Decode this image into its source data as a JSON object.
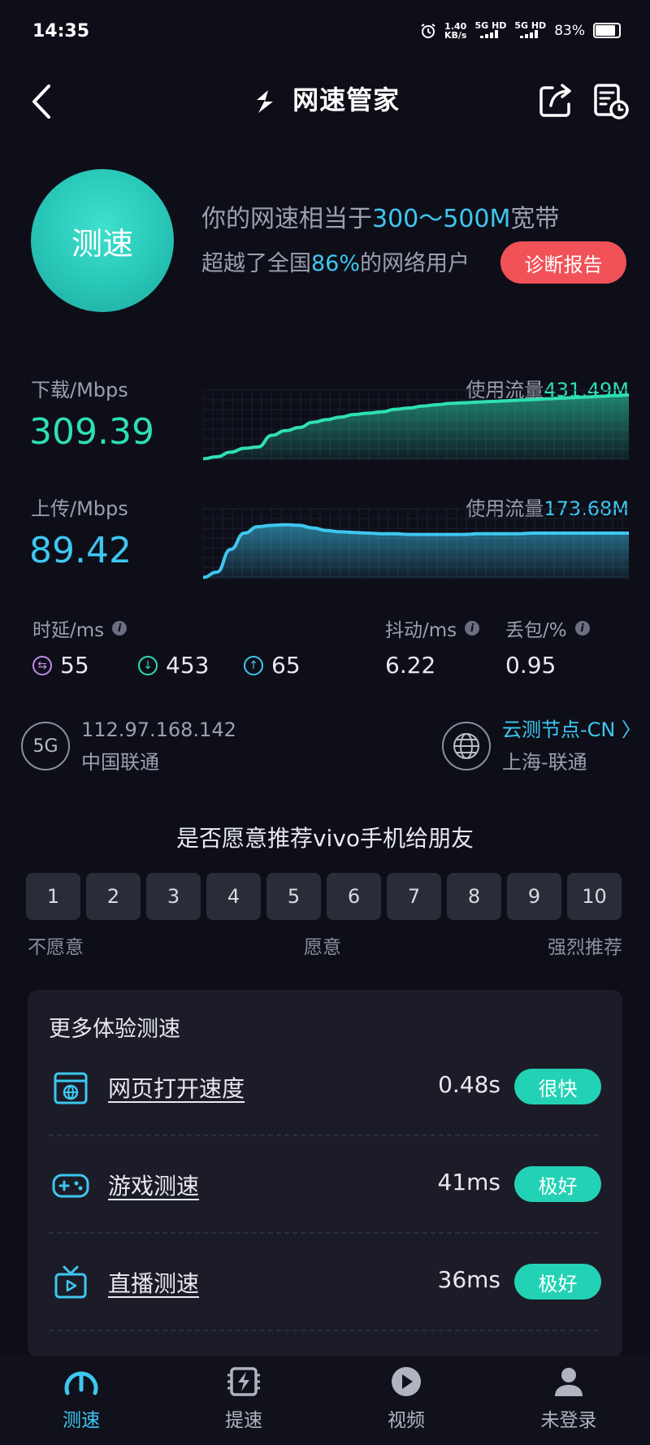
{
  "status": {
    "time": "14:35",
    "net_speed_top": "1.40",
    "net_speed_unit": "KB/s",
    "sim1": "5G HD",
    "sim2": "5G HD",
    "battery": "83%"
  },
  "header": {
    "title": "网速管家"
  },
  "hero": {
    "button": "测速",
    "line1_prefix": "你的网速相当于",
    "line1_highlight": "300～500M",
    "line1_suffix": "宽带",
    "line2_prefix": "超越了全国",
    "line2_highlight": "86%",
    "line2_suffix": "的网络用户",
    "report_button": "诊断报告"
  },
  "download": {
    "label": "下载/Mbps",
    "value": "309.39",
    "flow_label": "使用流量",
    "flow_value": "431.49M",
    "color": "#2ee0b4",
    "samples": [
      0.02,
      0.05,
      0.12,
      0.18,
      0.2,
      0.38,
      0.45,
      0.5,
      0.58,
      0.62,
      0.66,
      0.7,
      0.72,
      0.74,
      0.78,
      0.8,
      0.83,
      0.85,
      0.87,
      0.88,
      0.89,
      0.9,
      0.91,
      0.92,
      0.93,
      0.94,
      0.95,
      0.96,
      0.97,
      0.98,
      0.99,
      1.0
    ]
  },
  "upload": {
    "label": "上传/Mbps",
    "value": "89.42",
    "flow_label": "使用流量",
    "flow_value": "173.68M",
    "color": "#3ec7f0",
    "samples": [
      0.02,
      0.1,
      0.45,
      0.7,
      0.8,
      0.82,
      0.83,
      0.82,
      0.78,
      0.74,
      0.72,
      0.71,
      0.7,
      0.69,
      0.69,
      0.68,
      0.68,
      0.68,
      0.68,
      0.68,
      0.69,
      0.69,
      0.69,
      0.69,
      0.7,
      0.7,
      0.7,
      0.7,
      0.7,
      0.7,
      0.7,
      0.7
    ]
  },
  "metrics": {
    "latency_label": "时延/ms",
    "latency_idle": "55",
    "latency_down": "453",
    "latency_up": "65",
    "jitter_label": "抖动/ms",
    "jitter": "6.22",
    "loss_label": "丢包/%",
    "loss": "0.95"
  },
  "network": {
    "type": "5G",
    "ip": "112.97.168.142",
    "carrier": "中国联通",
    "node": "云测节点-CN",
    "node_location": "上海-联通"
  },
  "recommend": {
    "title": "是否愿意推荐vivo手机给朋友",
    "options": [
      "1",
      "2",
      "3",
      "4",
      "5",
      "6",
      "7",
      "8",
      "9",
      "10"
    ],
    "left_label": "不愿意",
    "mid_label": "愿意",
    "right_label": "强烈推荐"
  },
  "more": {
    "title": "更多体验测速",
    "items": [
      {
        "label": "网页打开速度",
        "value": "0.48s",
        "rating": "很快",
        "icon": "browser-globe-icon"
      },
      {
        "label": "游戏测速",
        "value": "41ms",
        "rating": "极好",
        "icon": "gamepad-icon"
      },
      {
        "label": "直播测速",
        "value": "36ms",
        "rating": "极好",
        "icon": "tv-icon"
      }
    ]
  },
  "nav": [
    {
      "label": "测速",
      "icon": "speedometer-icon"
    },
    {
      "label": "提速",
      "icon": "boost-chip-icon"
    },
    {
      "label": "视频",
      "icon": "play-icon"
    },
    {
      "label": "未登录",
      "icon": "user-icon"
    }
  ],
  "colors": {
    "accent_teal": "#23d2b4",
    "accent_blue": "#3ec7f0",
    "report_red": "#f05258",
    "background": "#0d0e18"
  }
}
